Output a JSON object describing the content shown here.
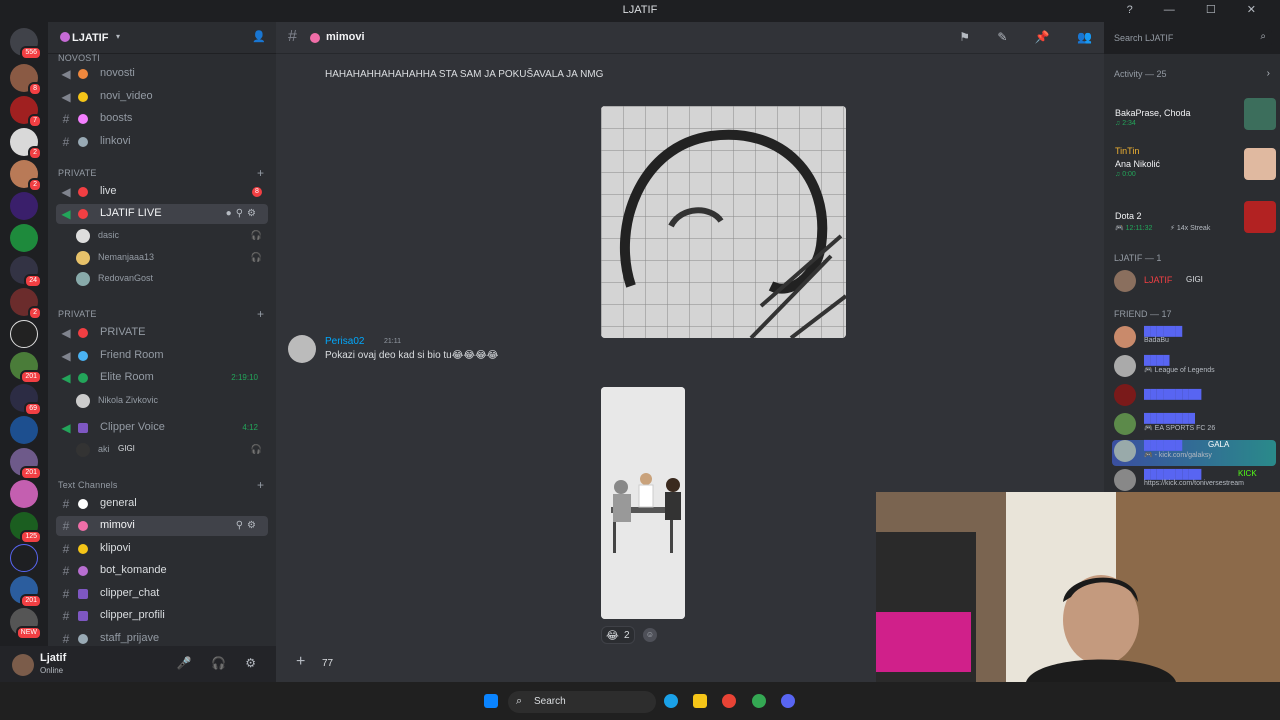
{
  "window": {
    "title": "LJATIF"
  },
  "server": {
    "name": "LJATIF"
  },
  "guild_badges": [
    "556",
    "8",
    "7",
    "2",
    "2",
    "24",
    "2",
    "201",
    "69",
    "201",
    "125",
    "201",
    "NEW"
  ],
  "channels": {
    "cat_top": "NOVOSTI",
    "novosti": "novosti",
    "novi_video": "novi_video",
    "boosts": "boosts",
    "linkovi": "linkovi",
    "cat_private1": "PRIVATE",
    "live": "live",
    "live_badge": "8",
    "ljatif_live": "LJATIF LIVE",
    "voice_users1": [
      "dasic",
      "Nemanjaaa13",
      "RedovanGost"
    ],
    "cat_private2": "PRIVATE",
    "private": "PRIVATE",
    "friend_room": "Friend Room",
    "elite_room": "Elite Room",
    "elite_timer": "2:19:10",
    "elite_user": "Nikola Zivkovic",
    "clipper_voice": "Clipper Voice",
    "clipper_timer": "4:12",
    "clipper_user": "aki",
    "clipper_user_tag": "GIGI",
    "cat_text": "Text Channels",
    "general": "general",
    "mimovi": "mimovi",
    "klipovi": "klipovi",
    "bot_komande": "bot_komande",
    "clipper_chat": "clipper_chat",
    "clipper_profili": "clipper_profili",
    "staff_prijave": "staff_prijave"
  },
  "user": {
    "name": "Ljatif",
    "status": "Online"
  },
  "header": {
    "channel": "mimovi",
    "search_placeholder": "Search LJATIF"
  },
  "messages": {
    "m1_text": "HAHAHAHHAHAHAHHA STA SAM JA POKUŠAVALA JA NMG",
    "m2_author": "Perisa02",
    "m2_time": "21:11",
    "m2_text": "Pokazi ovaj deo kad si bio tu😂😂😂😂",
    "reaction_emoji": "😂",
    "reaction_count": "2"
  },
  "composer": {
    "value": "77"
  },
  "members": {
    "activity_header": "Activity — 25",
    "activities": [
      {
        "name": "BakaPrase, Choda",
        "sub": "♫ 2:34"
      },
      {
        "title": "TinTin",
        "name": "Ana Nikolić",
        "sub": "♫ 0:00"
      },
      {
        "name": "Dota 2",
        "sub": "🎮 12:11:32",
        "extra": "⚡ 14x Streak"
      }
    ],
    "role1_header": "LJATIF — 1",
    "role1_member": "LJATIF",
    "role1_tag": "GIGI",
    "role2_header": "FRIEND — 17",
    "friends": [
      {
        "sub": "BadaBu"
      },
      {
        "sub": "🎮 League of Legends"
      },
      {
        "sub": ""
      },
      {
        "sub": "🎮 EA SPORTS FC 26"
      },
      {
        "sub": "🎮 - kick.com/galaksy",
        "tag": "GALA"
      },
      {
        "sub": "https://kick.com/toniversestream",
        "tag": "KICK"
      }
    ]
  },
  "taskbar": {
    "search": "Search"
  },
  "colors": {
    "accent": "#5865f2",
    "online": "#23a55a",
    "danger": "#f23f43",
    "link": "#00a8fc"
  }
}
